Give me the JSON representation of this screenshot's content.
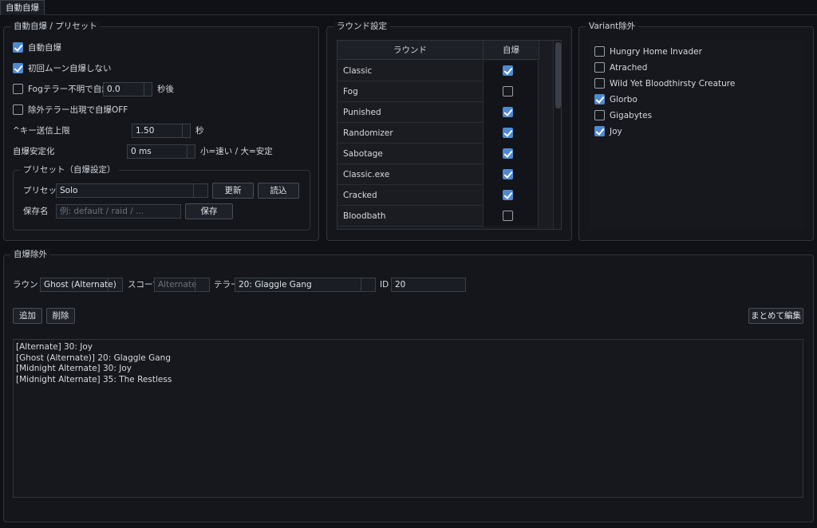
{
  "tab": {
    "label": "自動自爆"
  },
  "auto": {
    "title": "自動自爆 / プリセット",
    "enable_label": "自動自爆",
    "enable_checked": true,
    "skip_first_moon_label": "初回ムーン自爆しない",
    "skip_first_moon_checked": true,
    "fog_label": "Fogテラー不明で自爆",
    "fog_checked": false,
    "fog_value": "0.0",
    "fog_unit": "秒後",
    "exclude_off_label": "除外テラー出現で自爆OFF",
    "exclude_off_checked": false,
    "key_limit_label": "^キー送信上限",
    "key_limit_value": "1.50",
    "key_limit_unit": "秒",
    "stabilize_label": "自爆安定化",
    "stabilize_value": "0 ms",
    "stabilize_hint": "小=速い / 大=安定"
  },
  "preset": {
    "title": "プリセット（自爆設定）",
    "preset_label": "プリセット",
    "preset_value": "Solo",
    "update_button": "更新",
    "load_button": "読込",
    "save_name_label": "保存名",
    "save_name_placeholder": "例: default / raid / ...",
    "save_button": "保存"
  },
  "rounds": {
    "title": "ラウンド設定",
    "col_round": "ラウンド",
    "col_auto": "自爆",
    "rows": [
      {
        "name": "Classic",
        "checked": true
      },
      {
        "name": "Fog",
        "checked": false
      },
      {
        "name": "Punished",
        "checked": true
      },
      {
        "name": "Randomizer",
        "checked": true
      },
      {
        "name": "Sabotage",
        "checked": true
      },
      {
        "name": "Classic.exe",
        "checked": true
      },
      {
        "name": "Cracked",
        "checked": true
      },
      {
        "name": "Bloodbath",
        "checked": false
      }
    ]
  },
  "variants": {
    "title": "Variant除外",
    "items": [
      {
        "label": "Hungry Home Invader",
        "checked": false
      },
      {
        "label": "Atrached",
        "checked": false
      },
      {
        "label": "Wild Yet Bloodthirsty Creature",
        "checked": false
      },
      {
        "label": "Glorbo",
        "checked": true
      },
      {
        "label": "Gigabytes",
        "checked": false
      },
      {
        "label": "Joy",
        "checked": true
      }
    ]
  },
  "exclusions": {
    "title": "自爆除外",
    "round_label": "ラウンド",
    "round_value": "Ghost (Alternate)",
    "scope_label": "スコープ",
    "scope_placeholder": "Alternate",
    "terror_label": "テラー",
    "terror_value": "20: Glaggle Gang",
    "id_label": "ID",
    "id_value": "20",
    "add_button": "追加",
    "delete_button": "削除",
    "bulk_edit_button": "まとめて編集",
    "list": [
      "[Alternate] 30: Joy",
      "[Ghost (Alternate)] 20: Glaggle Gang",
      "[Midnight Alternate] 30: Joy",
      "[Midnight Alternate] 35: The Restless"
    ]
  },
  "colors": {
    "accent": "#4f8ad0",
    "background": "#0f1117",
    "panel": "#14161c"
  }
}
